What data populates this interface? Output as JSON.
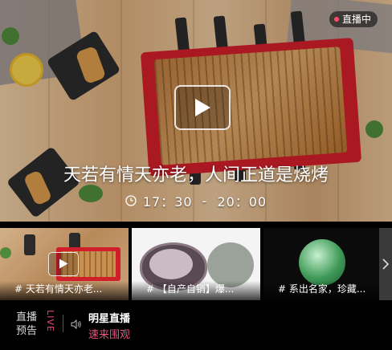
{
  "hero": {
    "badge": "直播中",
    "title": "天若有情天亦老，人间正道是烧烤",
    "time_start": "17：30",
    "time_separator": "-",
    "time_end": "20：00"
  },
  "thumbnails": [
    {
      "caption": "# 天若有情天亦老..."
    },
    {
      "caption": "# 【自产自销】爆..."
    },
    {
      "caption": "# 系出名家，珍藏..."
    }
  ],
  "footer": {
    "section_label_1": "直播",
    "section_label_2": "预告",
    "live_label": "LIVE",
    "title": "明星直播",
    "link": "速来围观"
  },
  "colors": {
    "accent": "#e8557f",
    "live_dot": "#ff4d6d"
  },
  "icons": [
    "play-icon",
    "clock-icon",
    "chevron-right-icon",
    "speaker-icon"
  ]
}
